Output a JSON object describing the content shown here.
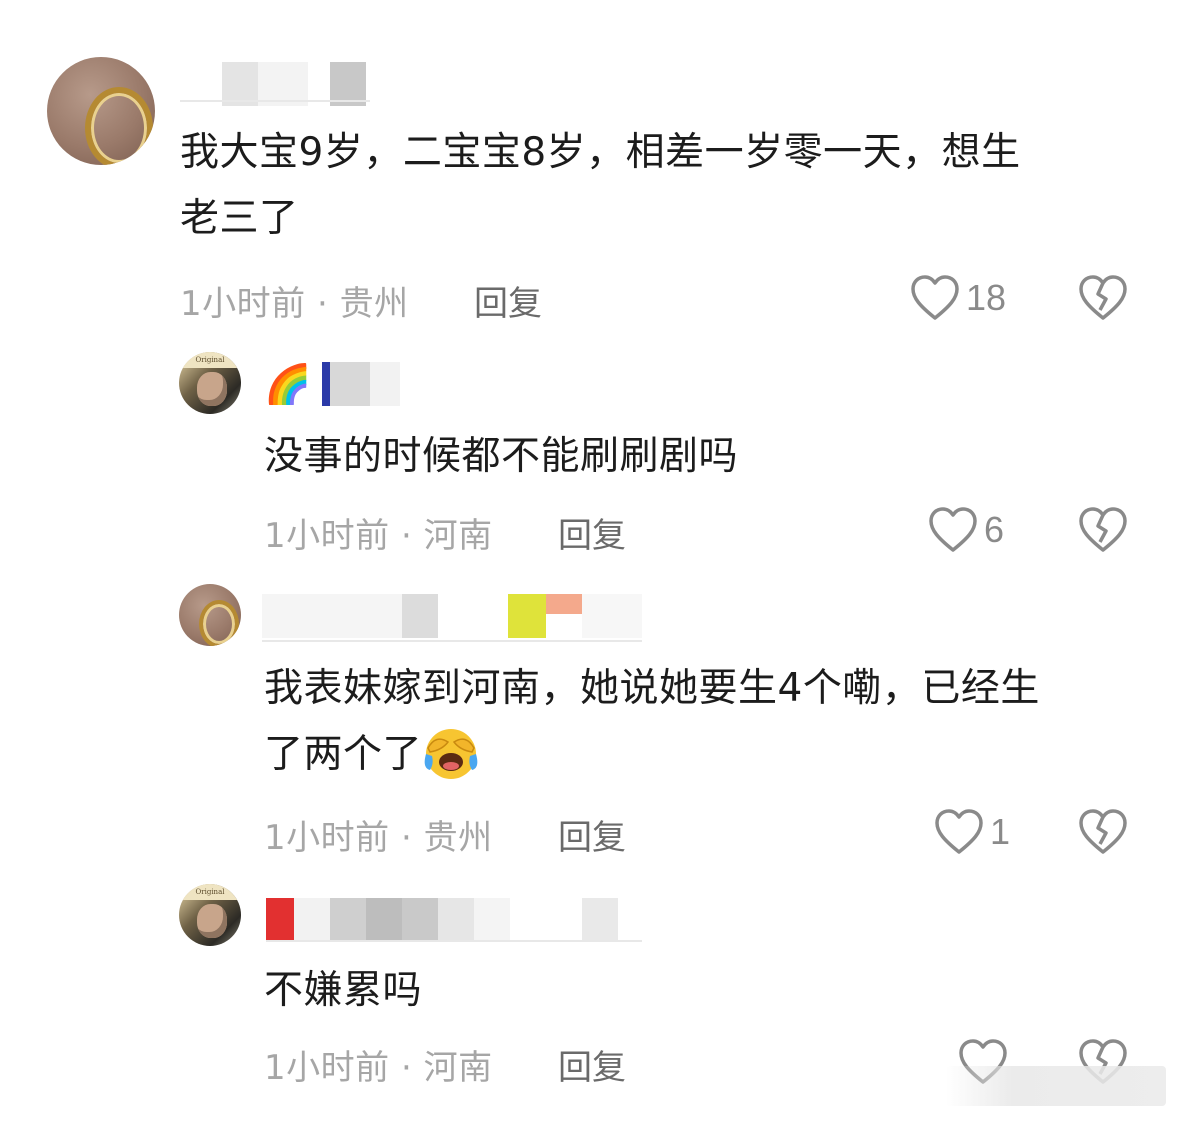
{
  "comments": [
    {
      "text": "我大宝9岁，二宝宝8岁，相差一岁零一天，想生老三了",
      "text_line1": "我大宝9岁，二宝宝8岁，相差一岁零一天，想生",
      "text_line2": "老三了",
      "time": "1小时前",
      "location": "贵州",
      "reply_label": "回复",
      "likes": "18",
      "avatar_icon": "ring-egg-avatar"
    },
    {
      "name_emoji": "🌈",
      "text": "没事的时候都不能刷刷剧吗",
      "time": "1小时前",
      "location": "河南",
      "reply_label": "回复",
      "likes": "6",
      "avatar_icon": "man-photo-avatar"
    },
    {
      "text_line1": "我表妹嫁到河南，她说她要生4个嘞，已经生",
      "text_line2": "了两个了",
      "emoji_icon": "laughing-crying-emoji-icon",
      "time": "1小时前",
      "location": "贵州",
      "reply_label": "回复",
      "likes": "1",
      "avatar_icon": "ring-egg-avatar"
    },
    {
      "text": "不嫌累吗",
      "time": "1小时前",
      "location": "河南",
      "reply_label": "回复",
      "likes": "",
      "avatar_icon": "man-photo-avatar"
    }
  ],
  "separator": "·",
  "colors": {
    "text": "#1c1c1c",
    "meta": "#a6a6a6",
    "reply": "#6a6a6a",
    "icon": "#8a8a8a"
  }
}
